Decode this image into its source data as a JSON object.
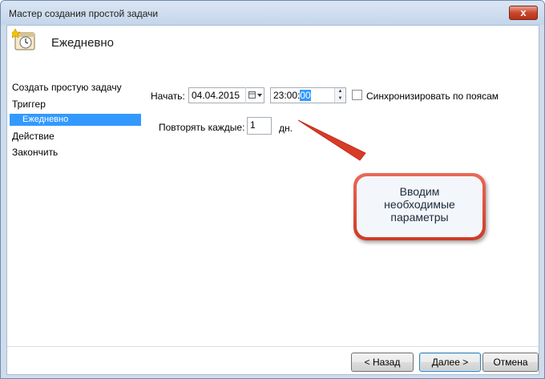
{
  "window": {
    "title": "Мастер создания простой задачи",
    "close_label": "x"
  },
  "header": {
    "title": "Ежедневно",
    "icon": "clock-calendar-icon"
  },
  "nav": {
    "items": [
      {
        "label": "Создать простую задачу"
      },
      {
        "label": "Триггер"
      },
      {
        "label": "Ежедневно",
        "selected": true
      },
      {
        "label": "Действие"
      },
      {
        "label": "Закончить"
      }
    ]
  },
  "form": {
    "start_label": "Начать:",
    "date_value": "04.04.2015",
    "time_value_prefix": "23:00:",
    "time_value_selected": "00",
    "sync_label": "Синхронизировать по поясам",
    "sync_checked": false,
    "repeat_label": "Повторять каждые:",
    "repeat_value": "1",
    "repeat_unit": "дн."
  },
  "annotation": {
    "line1": "Вводим",
    "line2": "необходимые",
    "line3": "параметры",
    "border_color": "#cf3a25"
  },
  "buttons": {
    "back": "< Назад",
    "next": "Далее >",
    "cancel": "Отмена"
  }
}
